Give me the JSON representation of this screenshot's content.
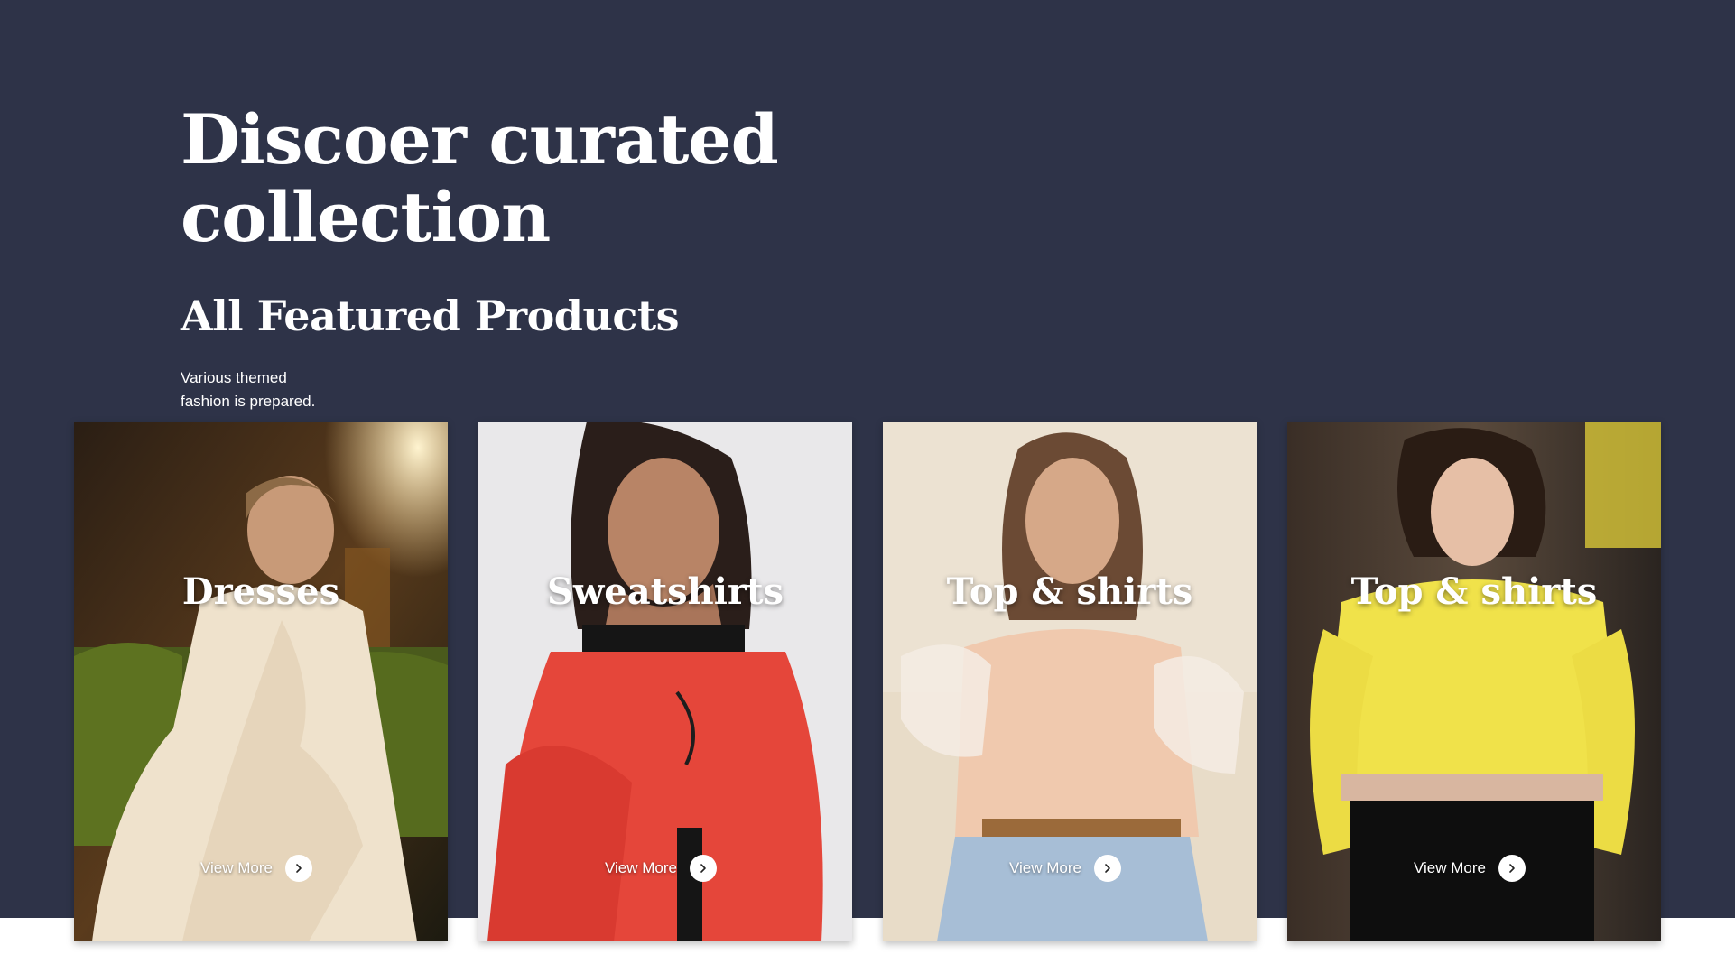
{
  "hero": {
    "headline_line1": "Discoer curated",
    "headline_line2": "collection",
    "section_title": "All Featured Products",
    "description_line1": "Various themed",
    "description_line2": "fashion is prepared.",
    "background_color": "#2e3348"
  },
  "cards": [
    {
      "title": "Dresses",
      "cta": "View More",
      "icon": "chevron-right-icon"
    },
    {
      "title": "Sweatshirts",
      "cta": "View More",
      "icon": "chevron-right-icon"
    },
    {
      "title": "Top & shirts",
      "cta": "View More",
      "icon": "chevron-right-icon"
    },
    {
      "title": "Top & shirts",
      "cta": "View More",
      "icon": "chevron-right-icon"
    }
  ]
}
